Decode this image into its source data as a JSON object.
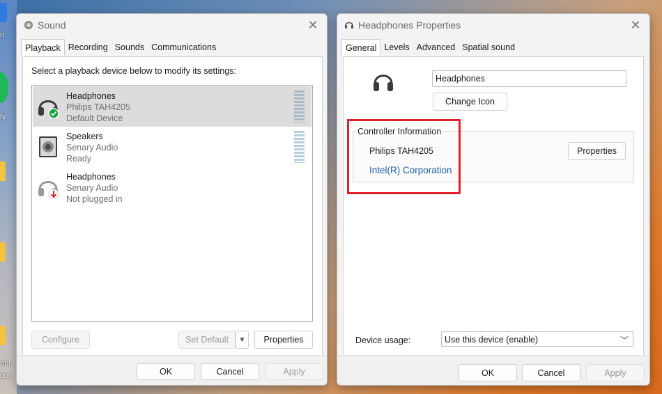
{
  "desktop": {
    "glyph_1": "n",
    "glyph_2": "fy",
    "glyph_3": "ent.",
    "glyph_4": "cut"
  },
  "sound_window": {
    "title": "Sound",
    "tabs": [
      {
        "label": "Playback",
        "active": true
      },
      {
        "label": "Recording",
        "active": false
      },
      {
        "label": "Sounds",
        "active": false
      },
      {
        "label": "Communications",
        "active": false
      }
    ],
    "instruction": "Select a playback device below to modify its settings:",
    "devices": [
      {
        "name": "Headphones",
        "driver": "Philips TAH4205",
        "status": "Default Device",
        "icon": "headphones-default-icon",
        "selected": true
      },
      {
        "name": "Speakers",
        "driver": "Senary Audio",
        "status": "Ready",
        "icon": "speaker-icon",
        "selected": false
      },
      {
        "name": "Headphones",
        "driver": "Senary Audio",
        "status": "Not plugged in",
        "icon": "headphones-unplugged-icon",
        "selected": false
      }
    ],
    "configure_label": "Configure",
    "set_default_label": "Set Default",
    "properties_label": "Properties",
    "ok_label": "OK",
    "cancel_label": "Cancel",
    "apply_label": "Apply"
  },
  "props_window": {
    "title": "Headphones Properties",
    "tabs": [
      {
        "label": "General",
        "active": true
      },
      {
        "label": "Levels",
        "active": false
      },
      {
        "label": "Advanced",
        "active": false
      },
      {
        "label": "Spatial sound",
        "active": false
      }
    ],
    "device_name_value": "Headphones",
    "change_icon_label": "Change Icon",
    "controller_group_label": "Controller Information",
    "controller_name": "Philips TAH4205",
    "controller_vendor": "Intel(R) Corporation",
    "controller_properties_label": "Properties",
    "device_usage_label": "Device usage:",
    "device_usage_value": "Use this device (enable)",
    "ok_label": "OK",
    "cancel_label": "Cancel",
    "apply_label": "Apply"
  },
  "colors": {
    "highlight": "#e0202a",
    "link_blue": "#1f5fa8",
    "default_check": "#1e9e3a",
    "unplugged_arrow": "#d6242a"
  }
}
